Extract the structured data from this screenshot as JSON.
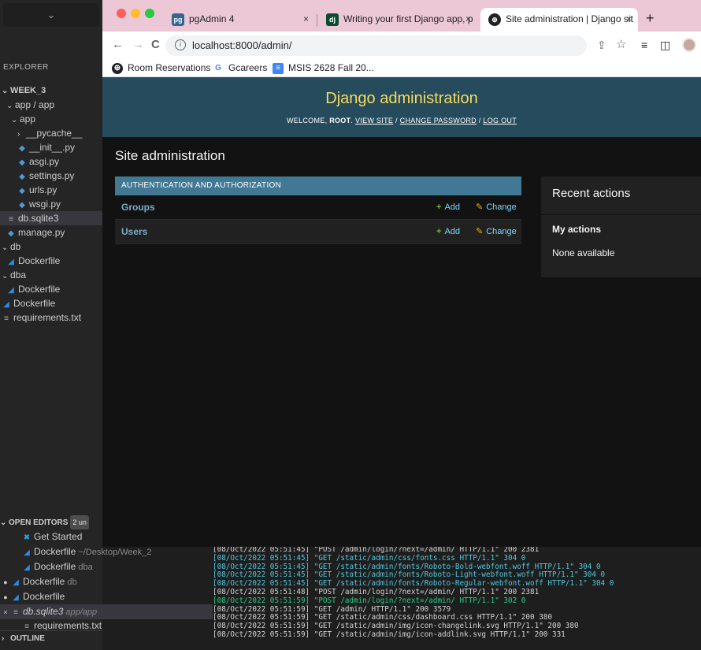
{
  "vscode": {
    "dropdown_chevron": "⌄",
    "explorer_title": "EXPLORER",
    "tree": [
      {
        "label": "WEEK_3",
        "twisty": "⌄",
        "icon": "",
        "bold": true
      },
      {
        "label": "app / app",
        "twisty": "⌄",
        "icon": ""
      },
      {
        "label": "app",
        "twisty": "⌄",
        "icon": ""
      },
      {
        "label": "__pycache__",
        "twisty": "›",
        "icon": ""
      },
      {
        "label": "__init__.py",
        "twisty": "",
        "icon": "python-file-icon"
      },
      {
        "label": "asgi.py",
        "twisty": "",
        "icon": "python-file-icon"
      },
      {
        "label": "settings.py",
        "twisty": "",
        "icon": "python-file-icon"
      },
      {
        "label": "urls.py",
        "twisty": "",
        "icon": "python-file-icon"
      },
      {
        "label": "wsgi.py",
        "twisty": "",
        "icon": "python-file-icon"
      },
      {
        "label": "db.sqlite3",
        "twisty": "",
        "icon": "text-file-icon",
        "selected": true
      },
      {
        "label": "manage.py",
        "twisty": "",
        "icon": "python-file-icon"
      },
      {
        "label": "db",
        "twisty": "⌄",
        "icon": ""
      },
      {
        "label": "Dockerfile",
        "twisty": "",
        "icon": "docker-icon"
      },
      {
        "label": "dba",
        "twisty": "⌄",
        "icon": ""
      },
      {
        "label": "Dockerfile",
        "twisty": "",
        "icon": "docker-icon"
      },
      {
        "label": "Dockerfile",
        "twisty": "",
        "icon": "docker-icon"
      },
      {
        "label": "requirements.txt",
        "twisty": "",
        "icon": "text-file-icon"
      }
    ],
    "open_editors": {
      "header": "OPEN EDITORS",
      "badge": "2 un",
      "items": [
        {
          "label": "Get Started",
          "hint": "",
          "mark": "",
          "icon": "vscode-icon"
        },
        {
          "label": "Dockerfile",
          "hint": "~/Desktop/Week_2",
          "mark": "",
          "icon": "docker-icon"
        },
        {
          "label": "Dockerfile",
          "hint": "dba",
          "mark": "",
          "icon": "docker-icon"
        },
        {
          "label": "Dockerfile",
          "hint": "db",
          "mark": "●",
          "icon": "docker-icon"
        },
        {
          "label": "Dockerfile",
          "hint": "",
          "mark": "●",
          "icon": "docker-icon"
        },
        {
          "label": "db.sqlite3",
          "hint": "app/app",
          "mark": "×",
          "icon": "text-file-icon",
          "selected": true,
          "italic": true
        },
        {
          "label": "requirements.txt",
          "hint": "",
          "mark": "",
          "icon": "text-file-icon"
        }
      ]
    },
    "outline_header": "OUTLINE"
  },
  "terminal": {
    "lines": [
      {
        "text": "[08/Oct/2022 05:51:45] \"POST /admin/login/?next=/admin/ HTTP/1.1\" 200 2381",
        "color": "white"
      },
      {
        "text": "[08/Oct/2022 05:51:45] \"GET /static/admin/css/fonts.css HTTP/1.1\" 304 0",
        "color": "cyan"
      },
      {
        "text": "[08/Oct/2022 05:51:45] \"GET /static/admin/fonts/Roboto-Bold-webfont.woff HTTP/1.1\" 304 0",
        "color": "cyan"
      },
      {
        "text": "[08/Oct/2022 05:51:45] \"GET /static/admin/fonts/Roboto-Light-webfont.woff HTTP/1.1\" 304 0",
        "color": "cyan"
      },
      {
        "text": "[08/Oct/2022 05:51:45] \"GET /static/admin/fonts/Roboto-Regular-webfont.woff HTTP/1.1\" 304 0",
        "color": "cyan"
      },
      {
        "text": "[08/Oct/2022 05:51:48] \"POST /admin/login/?next=/admin/ HTTP/1.1\" 200 2381",
        "color": "white"
      },
      {
        "text": "[08/Oct/2022 05:51:59] \"POST /admin/login/?next=/admin/ HTTP/1.1\" 302 0",
        "color": "green"
      },
      {
        "text": "[08/Oct/2022 05:51:59] \"GET /admin/ HTTP/1.1\" 200 3579",
        "color": "white"
      },
      {
        "text": "[08/Oct/2022 05:51:59] \"GET /static/admin/css/dashboard.css HTTP/1.1\" 200 380",
        "color": "white"
      },
      {
        "text": "[08/Oct/2022 05:51:59] \"GET /static/admin/img/icon-changelink.svg HTTP/1.1\" 200 380",
        "color": "white"
      },
      {
        "text": "[08/Oct/2022 05:51:59] \"GET /static/admin/img/icon-addlink.svg HTTP/1.1\" 200 331",
        "color": "white"
      }
    ]
  },
  "browser": {
    "traffic_lights": [
      "#fe5f57",
      "#febc2e",
      "#28c840"
    ],
    "tabs": [
      {
        "title": "pgAdmin 4",
        "favicon": "pg",
        "favicon_color": "#336791",
        "close": "×"
      },
      {
        "title": "Writing your first Django app, p",
        "favicon": "dj",
        "favicon_color": "#0c4b33",
        "close": "×"
      },
      {
        "title": "Site administration | Django sit",
        "favicon": "globe-icon",
        "close": "×",
        "active": true
      }
    ],
    "new_tab": "+",
    "nav": {
      "back": "←",
      "forward": "→",
      "reload": "C"
    },
    "url": "localhost:8000/admin/",
    "toolbar_icons": {
      "share": "⇪",
      "star": "☆",
      "reading_list": "≡",
      "sidepanel": "◫"
    },
    "bookmarks": [
      {
        "label": "Room Reservations",
        "icon": "globe-icon"
      },
      {
        "label": "Gcareers",
        "icon": "google-icon"
      },
      {
        "label": "MSIS 2628 Fall 20...",
        "icon": "docs-icon"
      }
    ]
  },
  "django": {
    "branding": "Django administration",
    "welcome": "WELCOME,",
    "user": "ROOT",
    "view_site": "VIEW SITE",
    "change_password": "CHANGE PASSWORD",
    "log_out": "LOG OUT",
    "site_title": "Site administration",
    "app_caption": "AUTHENTICATION AND AUTHORIZATION",
    "models": [
      {
        "name": "Groups",
        "add": "Add",
        "change": "Change"
      },
      {
        "name": "Users",
        "add": "Add",
        "change": "Change"
      }
    ],
    "recent_actions": "Recent actions",
    "my_actions": "My actions",
    "none_available": "None available",
    "colors": {
      "header_bg": "#264b5d",
      "branding": "#f5dd5d",
      "caption_bg": "#417893",
      "link": "#79aec8",
      "body_bg": "#121212"
    }
  }
}
